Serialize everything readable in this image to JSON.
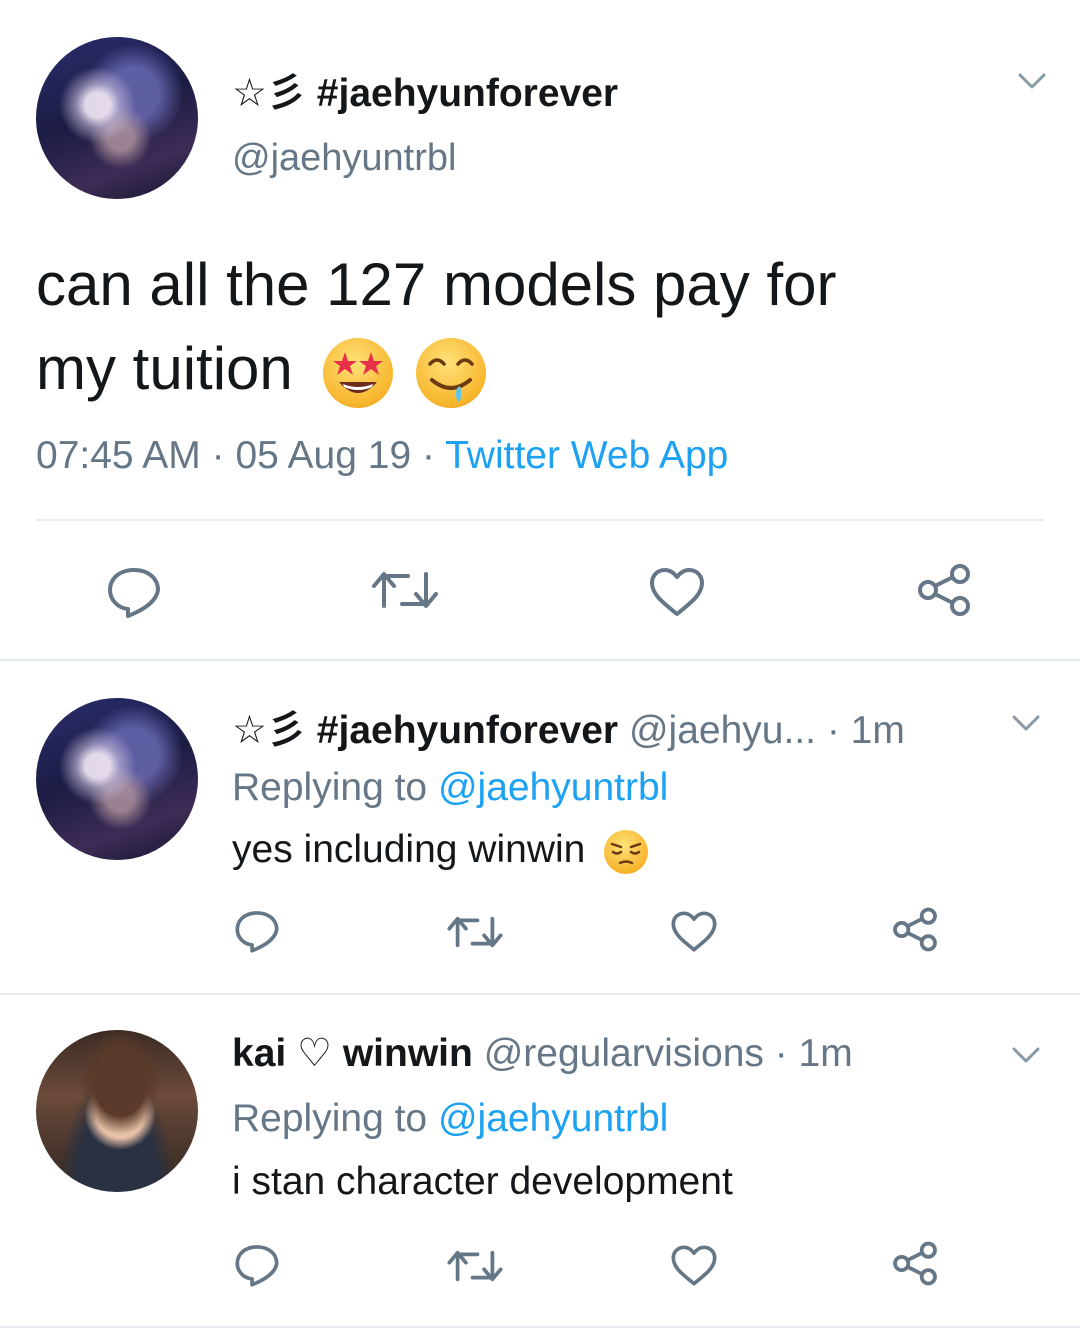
{
  "main_tweet": {
    "display_name": "☆彡 #jaehyunforever",
    "handle": "@jaehyuntrbl",
    "text_line1": "can all the 127 models pay for",
    "text_line2": "my tuition",
    "emojis": [
      "star-struck",
      "drooling-face"
    ],
    "time": "07:45 AM",
    "date": "05 Aug 19",
    "source": "Twitter Web App"
  },
  "replies": [
    {
      "display_name": "☆彡 #jaehyunforever",
      "handle": "@jaehyu...",
      "age": "· 1m",
      "replying_prefix": "Replying to",
      "replying_handle": "@jaehyuntrbl",
      "text": "yes including winwin",
      "emoji": "pensive-face"
    },
    {
      "display_name": "kai ♡ winwin",
      "handle": "@regularvisions",
      "age": "· 1m",
      "replying_prefix": "Replying to",
      "replying_handle": "@jaehyuntrbl",
      "text": "i stan character development"
    }
  ],
  "sep": "·",
  "colors": {
    "link": "#1da1f2",
    "muted": "#657786",
    "text": "#14171a",
    "divider": "#e6ecf0"
  },
  "icons": [
    "reply-icon",
    "retweet-icon",
    "like-icon",
    "share-icon",
    "chevron-down-icon"
  ]
}
